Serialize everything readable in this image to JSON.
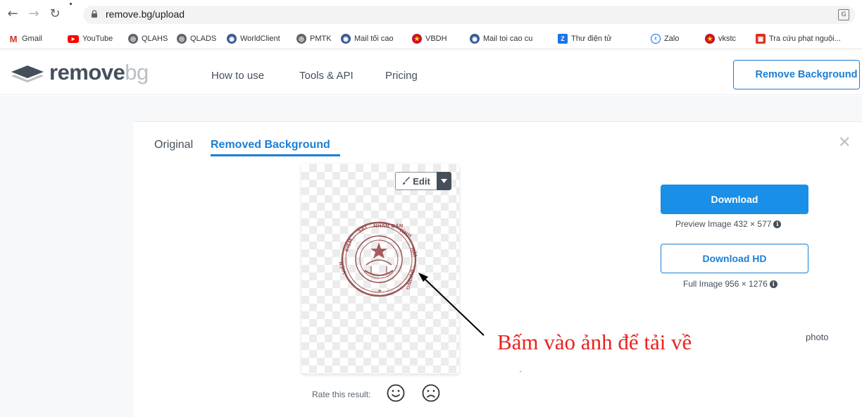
{
  "browser": {
    "url": "remove.bg/upload",
    "bookmarks": [
      {
        "label": "Gmail",
        "icon": "gmail-icon",
        "color": "#d93025"
      },
      {
        "label": "YouTube",
        "icon": "youtube-icon",
        "color": "#ff0000"
      },
      {
        "label": "QLAHS",
        "icon": "globe-icon",
        "color": "#5f6368"
      },
      {
        "label": "QLADS",
        "icon": "globe-icon",
        "color": "#5f6368"
      },
      {
        "label": "WorldClient",
        "icon": "worldclient-icon",
        "color": "#3b5998"
      },
      {
        "label": "PMTK",
        "icon": "globe-icon",
        "color": "#5f6368"
      },
      {
        "label": "Mail tối cao",
        "icon": "worldclient-icon",
        "color": "#3b5998"
      },
      {
        "label": "VBDH",
        "icon": "emblem-icon",
        "color": "#c8102e"
      },
      {
        "label": "Mail toi cao cu",
        "icon": "worldclient-icon",
        "color": "#3b5998"
      },
      {
        "label": "Thư điện tử",
        "icon": "z-icon",
        "color": "#1a73e8"
      },
      {
        "label": "Zalo",
        "icon": "zalo-icon",
        "color": "#0068ff"
      },
      {
        "label": "vkstc",
        "icon": "emblem-icon",
        "color": "#c8102e"
      },
      {
        "label": "Tra cứu phạt nguội...",
        "icon": "red-square-icon",
        "color": "#d93025"
      }
    ]
  },
  "site": {
    "logo_bold": "remove",
    "logo_light": "bg",
    "nav": [
      "How to use",
      "Tools & API",
      "Pricing"
    ],
    "header_button": "Remove Background"
  },
  "result": {
    "tabs": [
      "Original",
      "Removed Background"
    ],
    "active_tab": "Removed Background",
    "edit_label": "Edit",
    "rate_label": "Rate this result:",
    "download_label": "Download",
    "preview_info": "Preview Image 432 × 577",
    "download_hd_label": "Download HD",
    "full_info": "Full Image 956 × 1276",
    "partial_text": "photo"
  },
  "annotation": {
    "text": "Bấm vào ảnh để tải về",
    "color": "#e8231f"
  },
  "colors": {
    "accent": "#1a7fd6",
    "button_fill": "#1a8fe8",
    "text_dark": "#454f5b"
  }
}
